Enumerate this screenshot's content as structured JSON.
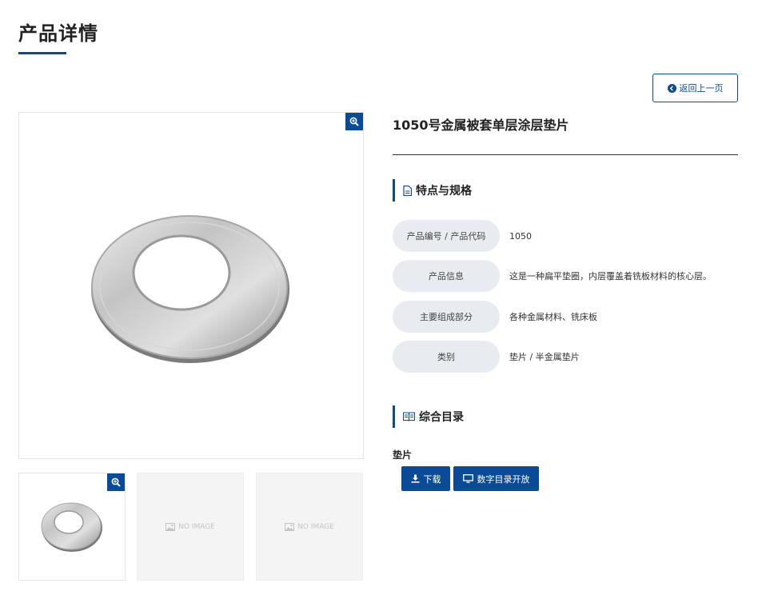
{
  "page": {
    "title": "产品详情"
  },
  "nav": {
    "back_label": "返回上一页"
  },
  "product": {
    "name": "1050号金属被套单层涂层垫片",
    "no_image_text": "NO IMAGE"
  },
  "specs": {
    "heading": "特点与规格",
    "rows": [
      {
        "label": "产品编号 / 产品代码",
        "value": "1050"
      },
      {
        "label": "产品信息",
        "value": "这是一种扁平垫圈，内层覆盖着铣板材料的核心层。"
      },
      {
        "label": "主要组成部分",
        "value": "各种金属材料、铣床板"
      },
      {
        "label": "类别",
        "value": "垫片 / 半金属垫片"
      }
    ]
  },
  "catalog": {
    "heading": "综合目录",
    "item_name": "垫片",
    "download_label": "下载",
    "open_label": "数字目录开放"
  },
  "colors": {
    "accent": "#0a4a96",
    "label_bg": "#e8ebef"
  },
  "icons": [
    "arrow-left-circle-icon",
    "zoom-in-icon",
    "image-icon",
    "document-icon",
    "book-icon",
    "download-icon",
    "monitor-icon"
  ]
}
